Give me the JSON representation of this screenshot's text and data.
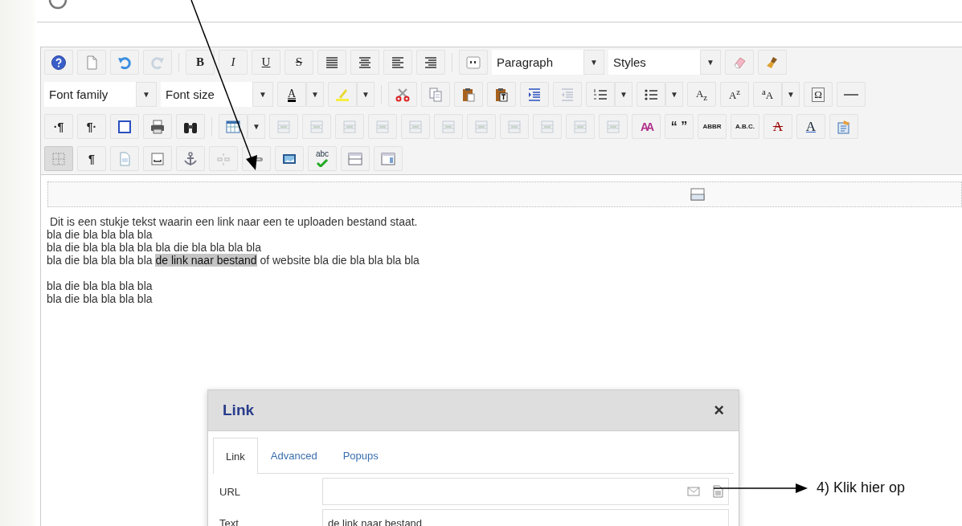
{
  "toolbar": {
    "rows": [
      {
        "items": [
          {
            "kind": "icon",
            "disabled": false,
            "pressed": false
          },
          {
            "kind": "icon",
            "disabled": false,
            "pressed": false
          },
          {
            "kind": "icon",
            "disabled": false,
            "pressed": false
          },
          {
            "kind": "icon",
            "disabled": true,
            "pressed": false
          },
          {
            "kind": "separator"
          },
          {
            "kind": "glyph",
            "glyph": "B",
            "disabled": false,
            "pressed": false
          },
          {
            "kind": "glyph",
            "glyph": "I",
            "disabled": false,
            "pressed": false
          },
          {
            "kind": "glyph",
            "glyph": "U",
            "disabled": false,
            "pressed": false
          },
          {
            "kind": "glyph",
            "glyph": "S",
            "disabled": false,
            "pressed": false
          },
          {
            "kind": "icon",
            "disabled": false,
            "pressed": false
          },
          {
            "kind": "icon",
            "disabled": false,
            "pressed": false
          },
          {
            "kind": "icon",
            "disabled": false,
            "pressed": false
          },
          {
            "kind": "icon",
            "disabled": false,
            "pressed": false
          },
          {
            "kind": "separator"
          },
          {
            "kind": "icon",
            "disabled": false,
            "pressed": false
          },
          {
            "kind": "select",
            "value": "Paragraph",
            "arrow": "▼"
          },
          {
            "kind": "select",
            "value": "Styles",
            "arrow": "▼"
          },
          {
            "kind": "icon",
            "disabled": false,
            "pressed": false
          },
          {
            "kind": "icon",
            "disabled": false,
            "pressed": false
          }
        ]
      },
      {
        "items": [
          {
            "kind": "select",
            "value": "Font family",
            "arrow": "▼"
          },
          {
            "kind": "select",
            "value": "Font size",
            "arrow": "▼"
          },
          {
            "kind": "glyph",
            "glyph": "A",
            "disabled": false,
            "pressed": false
          },
          {
            "kind": "split",
            "arrow": "▼"
          },
          {
            "kind": "icon",
            "disabled": false,
            "pressed": false
          },
          {
            "kind": "split",
            "arrow": "▼"
          },
          {
            "kind": "separator"
          },
          {
            "kind": "icon",
            "disabled": false,
            "pressed": false
          },
          {
            "kind": "icon",
            "disabled": false,
            "pressed": false
          },
          {
            "kind": "icon",
            "disabled": false,
            "pressed": false
          },
          {
            "kind": "icon",
            "disabled": false,
            "pressed": false
          },
          {
            "kind": "icon",
            "disabled": false,
            "pressed": false
          },
          {
            "kind": "icon",
            "disabled": true,
            "pressed": false
          },
          {
            "kind": "icon",
            "disabled": false,
            "pressed": false
          },
          {
            "kind": "split",
            "arrow": "▼"
          },
          {
            "kind": "icon",
            "disabled": false,
            "pressed": false
          },
          {
            "kind": "split",
            "arrow": "▼"
          },
          {
            "kind": "glyph",
            "glyph": "A$_{z}$",
            "disabled": false,
            "pressed": false
          },
          {
            "kind": "glyph",
            "glyph": "A$^{z}$",
            "disabled": false,
            "pressed": false
          },
          {
            "kind": "glyph",
            "glyph": "$^{a}$A",
            "disabled": false,
            "pressed": false
          },
          {
            "kind": "split",
            "arrow": "▼"
          },
          {
            "kind": "glyph",
            "glyph": "Ω",
            "disabled": false,
            "pressed": false
          },
          {
            "kind": "icon",
            "disabled": false,
            "pressed": false
          }
        ]
      },
      {
        "items": [
          {
            "kind": "glyph",
            "glyph": "·¶",
            "disabled": false,
            "pressed": false
          },
          {
            "kind": "glyph",
            "glyph": "¶·",
            "disabled": false,
            "pressed": false
          },
          {
            "kind": "icon",
            "disabled": false,
            "pressed": false
          },
          {
            "kind": "icon",
            "disabled": false,
            "pressed": false
          },
          {
            "kind": "icon",
            "disabled": false,
            "pressed": false
          },
          {
            "kind": "separator"
          },
          {
            "kind": "icon",
            "disabled": false,
            "pressed": false
          },
          {
            "kind": "split",
            "arrow": "▼"
          },
          {
            "kind": "icon",
            "disabled": true,
            "pressed": false
          },
          {
            "kind": "icon",
            "disabled": true,
            "pressed": false
          },
          {
            "kind": "icon",
            "disabled": true,
            "pressed": false
          },
          {
            "kind": "icon",
            "disabled": true,
            "pressed": false
          },
          {
            "kind": "icon",
            "disabled": true,
            "pressed": false
          },
          {
            "kind": "icon",
            "disabled": true,
            "pressed": false
          },
          {
            "kind": "icon",
            "disabled": true,
            "pressed": false
          },
          {
            "kind": "icon",
            "disabled": true,
            "pressed": false
          },
          {
            "kind": "icon",
            "disabled": true,
            "pressed": false
          },
          {
            "kind": "icon",
            "disabled": true,
            "pressed": false
          },
          {
            "kind": "icon",
            "disabled": true,
            "pressed": false
          },
          {
            "kind": "glyph",
            "glyph": "AA",
            "disabled": false,
            "pressed": false
          },
          {
            "kind": "glyph",
            "glyph": "“ ”",
            "disabled": false,
            "pressed": false
          },
          {
            "kind": "glyph",
            "glyph": "ABBR",
            "disabled": false,
            "pressed": false
          },
          {
            "kind": "glyph",
            "glyph": "A.B.C.",
            "disabled": false,
            "pressed": false
          },
          {
            "kind": "glyph",
            "glyph": "A",
            "disabled": false,
            "pressed": false
          },
          {
            "kind": "glyph",
            "glyph": "A",
            "disabled": false,
            "pressed": false
          },
          {
            "kind": "icon",
            "disabled": false,
            "pressed": false
          }
        ]
      },
      {
        "items": [
          {
            "kind": "icon",
            "disabled": false,
            "pressed": true
          },
          {
            "kind": "glyph",
            "glyph": "¶",
            "disabled": false,
            "pressed": false
          },
          {
            "kind": "icon",
            "disabled": false,
            "pressed": false
          },
          {
            "kind": "icon",
            "disabled": false,
            "pressed": false
          },
          {
            "kind": "icon",
            "disabled": false,
            "pressed": false
          },
          {
            "kind": "icon",
            "disabled": true,
            "pressed": false
          },
          {
            "kind": "icon",
            "disabled": false,
            "pressed": false
          },
          {
            "kind": "icon",
            "disabled": false,
            "pressed": false
          },
          {
            "kind": "glyph",
            "glyph": "abc",
            "disabled": false,
            "pressed": false
          },
          {
            "kind": "icon",
            "disabled": false,
            "pressed": false
          },
          {
            "kind": "icon",
            "disabled": false,
            "pressed": false
          }
        ]
      }
    ]
  },
  "content": {
    "paragraphs": [
      [
        {
          "text": " Dit is een stukje tekst waarin een link naar een te uploaden bestand staat."
        },
        {
          "text": "bla die bla bla bla bla"
        },
        {
          "text": "bla die bla bla bla bla bla die bla bla bla bla"
        },
        {
          "text": "bla die bla bla bla bla ",
          "highlight": "de link naar bestand",
          "after": " of website bla die bla bla bla bla"
        }
      ],
      [
        {
          "text": "bla die bla bla bla bla"
        },
        {
          "text": "bla die bla bla bla bla"
        }
      ]
    ]
  },
  "dialog": {
    "title": "Link",
    "close": "×",
    "tabs": [
      {
        "label": "Link",
        "selected": true
      },
      {
        "label": "Advanced",
        "selected": false
      },
      {
        "label": "Popups",
        "selected": false
      }
    ],
    "fields": [
      {
        "label": "URL",
        "kind": "browse"
      },
      {
        "label": "Text",
        "kind": "plain",
        "value": "de link naar bestand"
      }
    ]
  },
  "annotation": {
    "text": "4) Klik hier op"
  }
}
